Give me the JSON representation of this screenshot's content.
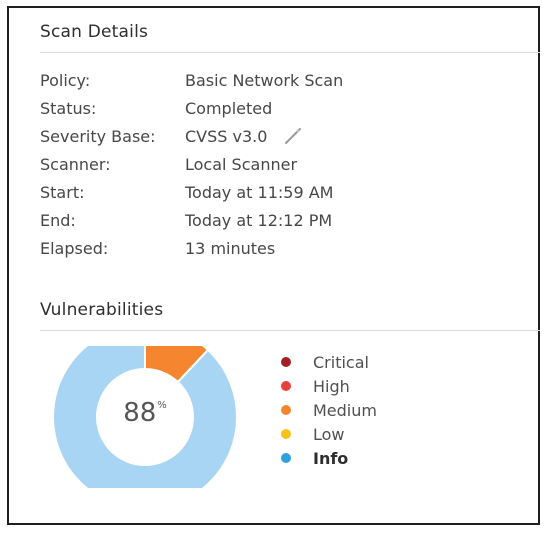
{
  "scan_details": {
    "title": "Scan Details",
    "rows": [
      {
        "label": "Policy:",
        "value": "Basic Network Scan"
      },
      {
        "label": "Status:",
        "value": "Completed"
      },
      {
        "label": "Severity Base:",
        "value": "CVSS v3.0",
        "icon": "pencil-icon"
      },
      {
        "label": "Scanner:",
        "value": "Local Scanner"
      },
      {
        "label": "Start:",
        "value": "Today at 11:59 AM"
      },
      {
        "label": "End:",
        "value": "Today at 12:12 PM"
      },
      {
        "label": "Elapsed:",
        "value": "13 minutes"
      }
    ]
  },
  "vulnerabilities": {
    "title": "Vulnerabilities",
    "donut": {
      "center_value": "88",
      "center_unit": "%",
      "segments": [
        {
          "name": "Medium",
          "fraction": 0.12,
          "color": "#f5862f"
        },
        {
          "name": "Info",
          "fraction": 0.88,
          "color": "#a9d5f5"
        }
      ]
    },
    "legend": [
      {
        "label": "Critical",
        "color": "#a31f24"
      },
      {
        "label": "High",
        "color": "#e8403a"
      },
      {
        "label": "Medium",
        "color": "#f5862f"
      },
      {
        "label": "Low",
        "color": "#f8c21a"
      },
      {
        "label": "Info",
        "color": "#2f9fe0",
        "active": true
      }
    ]
  }
}
